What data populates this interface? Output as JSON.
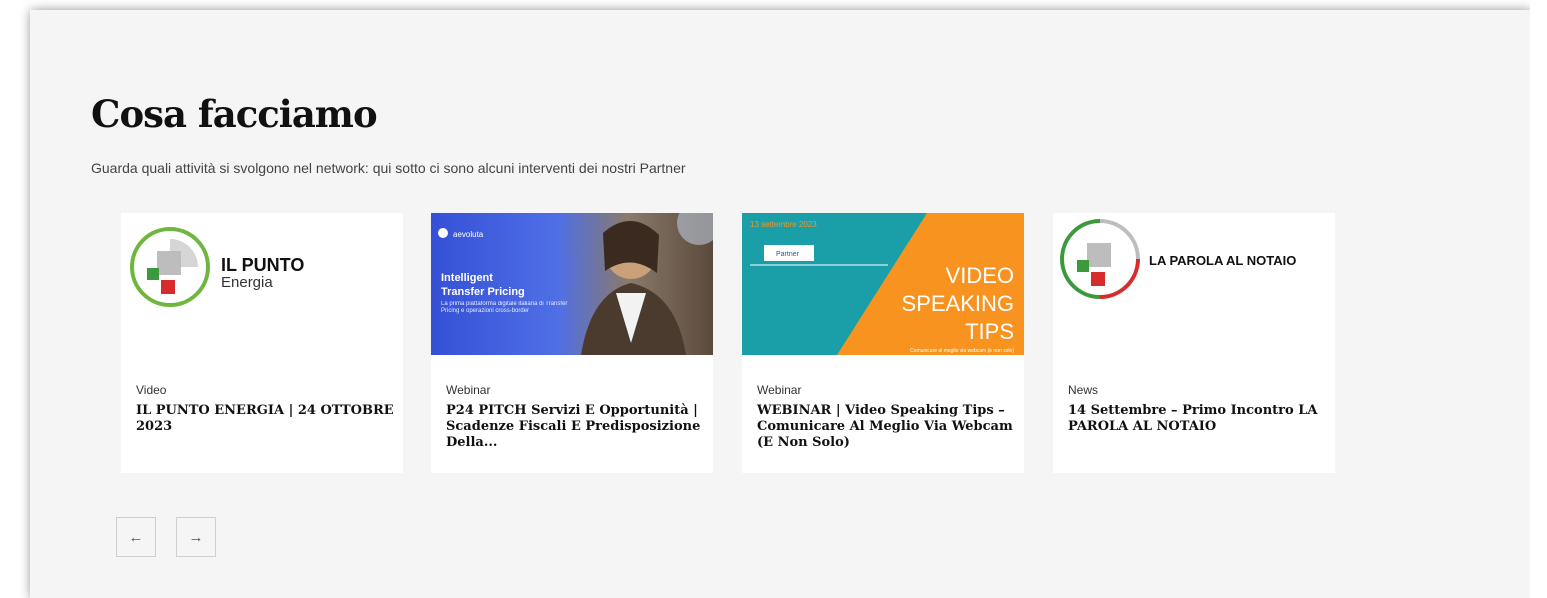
{
  "section": {
    "title": "Cosa facciamo",
    "subtitle": "Guarda quali attività si svolgono nel network: qui sotto ci sono alcuni interventi dei nostri Partner"
  },
  "cards": [
    {
      "type": "Video",
      "title": "IL PUNTO ENERGIA | 24 OTTOBRE 2023",
      "thumb": {
        "line1": "IL PUNTO",
        "line2": "Energia",
        "accent": "#6fb63f"
      }
    },
    {
      "type": "Webinar",
      "title": "P24 PITCH Servizi E Opportunità | Scadenze Fiscali E Predisposizione Della...",
      "thumb": {
        "brand": "aevoluta",
        "headline1": "Intelligent",
        "headline2": "Transfer Pricing",
        "body": "La prima piattaforma digitale italiana di Transfer Pricing e operazioni cross-border",
        "bg": "#3c5fd8"
      }
    },
    {
      "type": "Webinar",
      "title": "WEBINAR | Video Speaking Tips – Comunicare Al Meglio Via Webcam (E Non Solo)",
      "thumb": {
        "date": "13 settembre 2023",
        "badge": "Partner",
        "line1": "VIDEO",
        "line2": "SPEAKING",
        "line3": "TIPS",
        "footer": "Comunicare al meglio via webcam (e non solo)",
        "teal": "#1a9fa9",
        "orange": "#f7931e"
      }
    },
    {
      "type": "News",
      "title": "14 Settembre – Primo Incontro LA PAROLA AL NOTAIO",
      "thumb": {
        "label": "LA PAROLA AL NOTAIO"
      }
    }
  ],
  "carousel": {
    "prev_icon": "←",
    "next_icon": "→"
  }
}
